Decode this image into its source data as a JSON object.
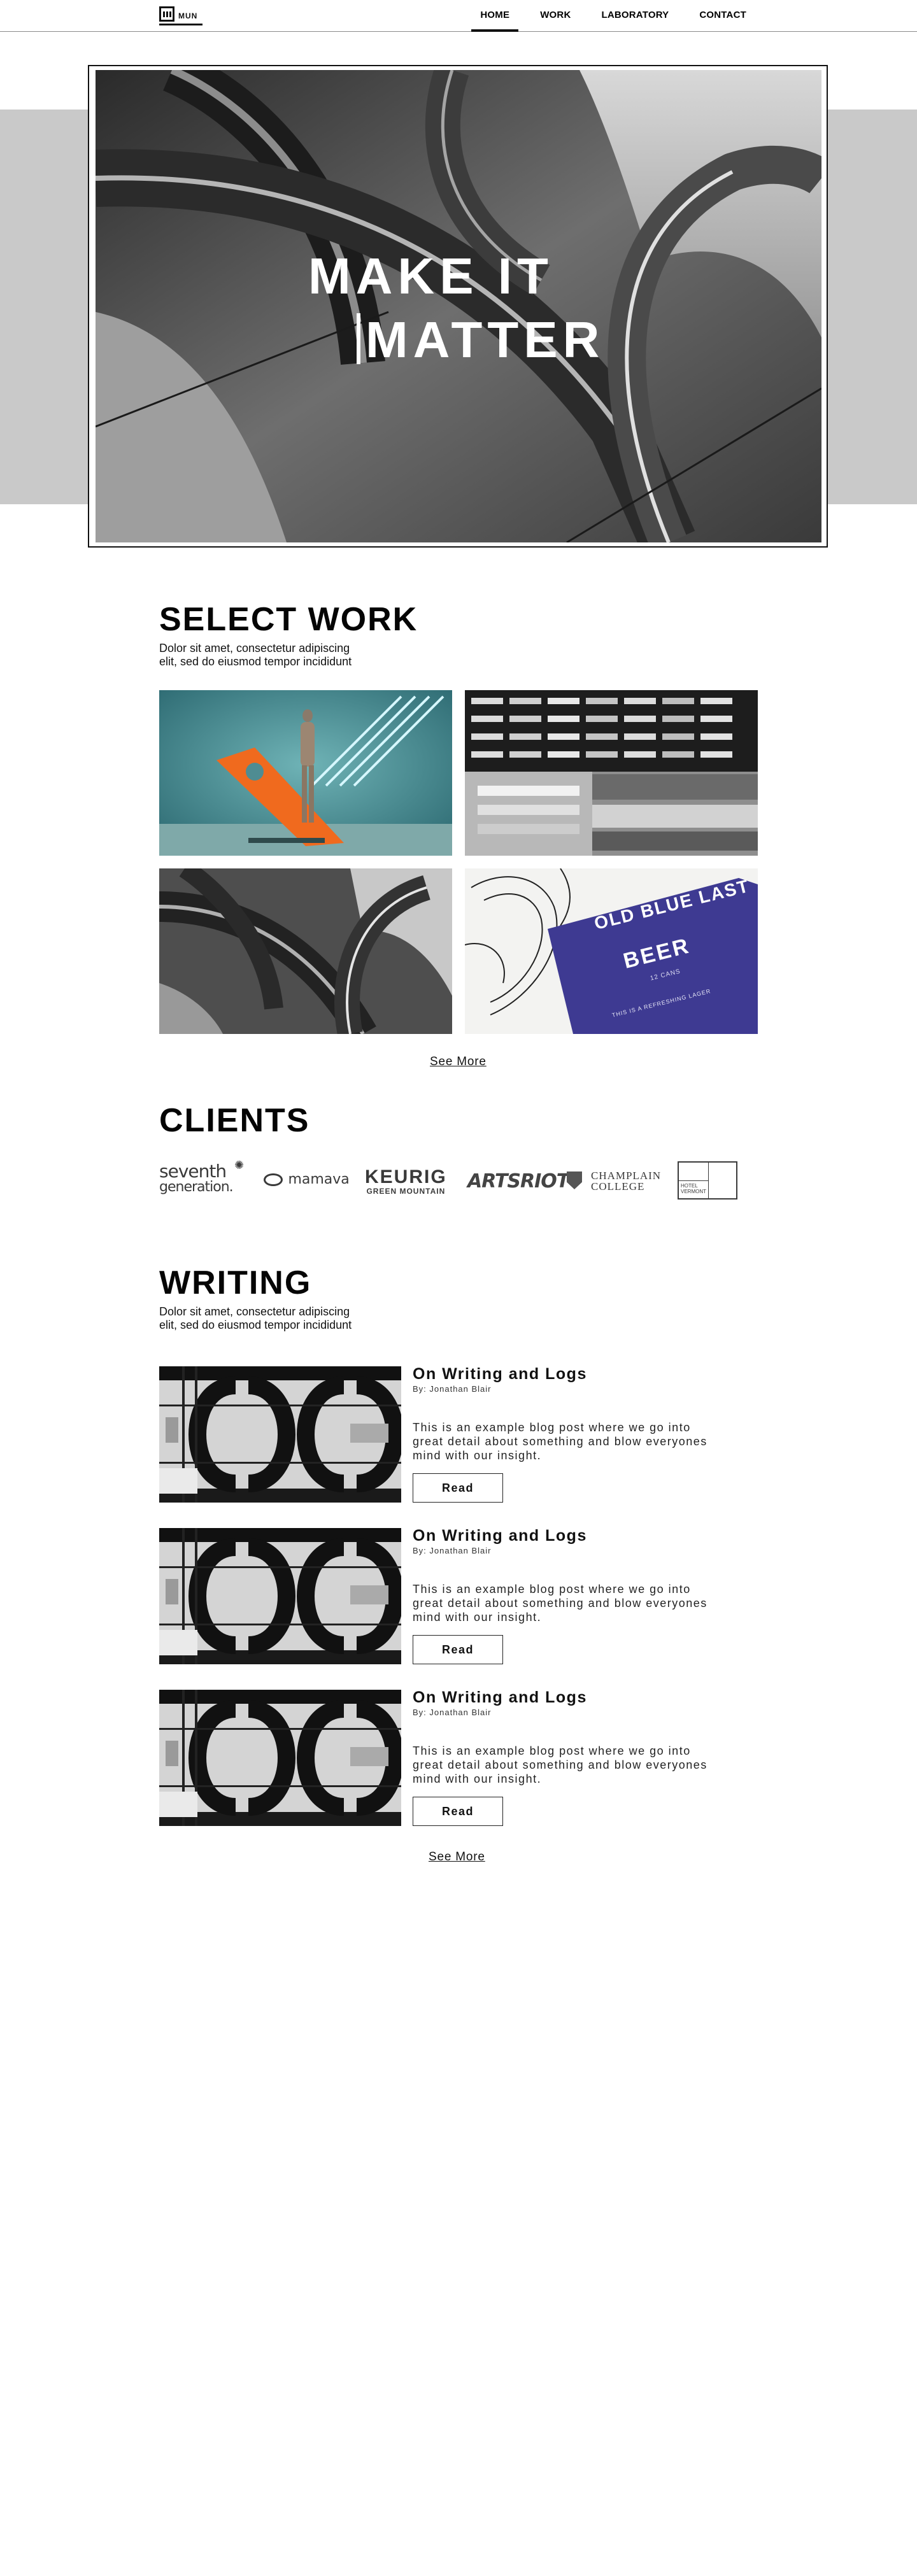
{
  "brand": {
    "logo_text": "MUN"
  },
  "nav": {
    "items": [
      {
        "label": "HOME",
        "active": true
      },
      {
        "label": "WORK",
        "active": false
      },
      {
        "label": "LABORATORY",
        "active": false
      },
      {
        "label": "CONTACT",
        "active": false
      }
    ]
  },
  "hero": {
    "line1": "MAKE IT",
    "line2": "MATTER"
  },
  "select_work": {
    "title": "SELECT WORK",
    "subtitle": "Dolor sit amet, consectetur adipiscing elit, sed do eiusmod tempor incididunt",
    "see_more": "See More",
    "beer_can": {
      "line1": "OLD BLUE LAST",
      "line2": "BEER",
      "small": "12 CANS",
      "tagline": "THIS IS A REFRESHING LAGER"
    }
  },
  "clients": {
    "title": "CLIENTS",
    "logos": [
      {
        "line1": "seventh",
        "line2": "generation."
      },
      {
        "line1": "mamava"
      },
      {
        "line1": "KEURIG",
        "line2": "GREEN MOUNTAIN"
      },
      {
        "line1": "ARTSRIOT"
      },
      {
        "line1": "CHAMPLAIN",
        "line2": "COLLEGE"
      },
      {
        "line1": "HOTEL",
        "line2": "VERMONT"
      }
    ]
  },
  "writing": {
    "title": "WRITING",
    "subtitle": "Dolor sit amet, consectetur adipiscing elit, sed do eiusmod tempor incididunt",
    "see_more": "See More",
    "posts": [
      {
        "title": "On Writing and Logs",
        "author": "By: Jonathan Blair",
        "excerpt": "This is an example blog post where we go into great detail about something and blow everyones mind with our insight.",
        "button": "Read"
      },
      {
        "title": "On Writing and Logs",
        "author": "By: Jonathan Blair",
        "excerpt": "This is an example blog post where we go into great detail about something and blow everyones mind with our insight.",
        "button": "Read"
      },
      {
        "title": "On Writing and Logs",
        "author": "By: Jonathan Blair",
        "excerpt": "This is an example blog post where we go into great detail about something and blow everyones mind with our insight.",
        "button": "Read"
      }
    ]
  },
  "colors": {
    "band": "#c9c9c9",
    "accent_orange": "#f06a1e",
    "can_blue": "#3e3a92",
    "teal": "#3f8f96"
  }
}
